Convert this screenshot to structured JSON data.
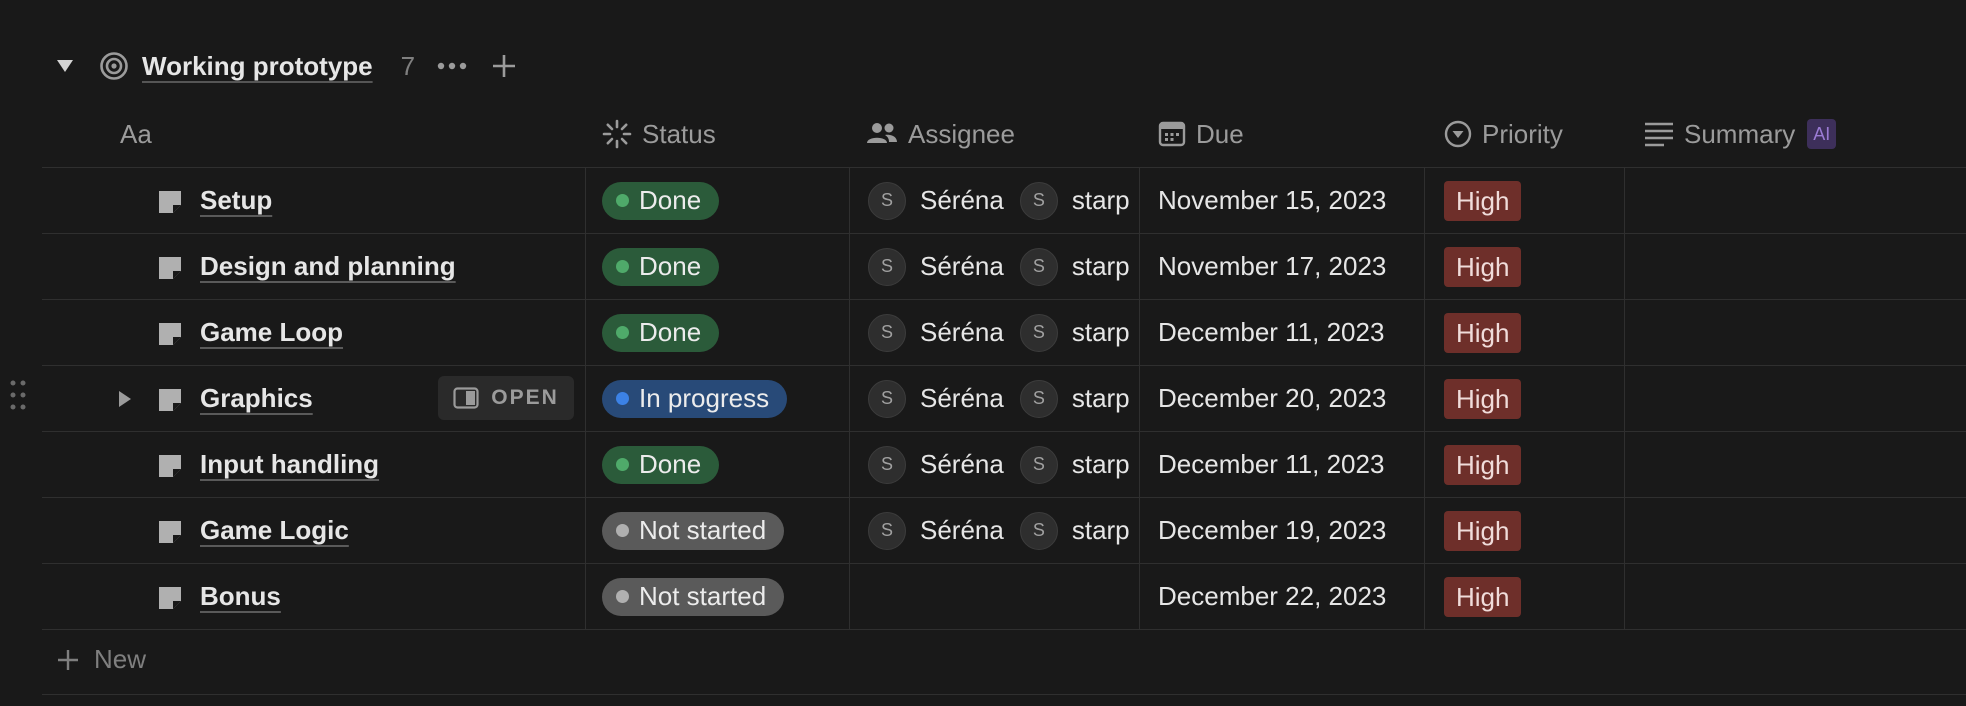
{
  "group": {
    "title": "Working prototype",
    "count": "7"
  },
  "columns": {
    "name": "Aa",
    "status": "Status",
    "assignee": "Assignee",
    "due": "Due",
    "priority": "Priority",
    "summary": "Summary",
    "summary_badge": "AI"
  },
  "rows": [
    {
      "title": "Setup",
      "status": "Done",
      "assignee1_initial": "S",
      "assignee1": "Séréna",
      "assignee2_initial": "S",
      "assignee2": "starp",
      "due": "November 15, 2023",
      "priority": "High"
    },
    {
      "title": "Design and planning",
      "status": "Done",
      "assignee1_initial": "S",
      "assignee1": "Séréna",
      "assignee2_initial": "S",
      "assignee2": "starp",
      "due": "November 17, 2023",
      "priority": "High"
    },
    {
      "title": "Game Loop",
      "status": "Done",
      "assignee1_initial": "S",
      "assignee1": "Séréna",
      "assignee2_initial": "S",
      "assignee2": "starp",
      "due": "December 11, 2023",
      "priority": "High"
    },
    {
      "title": "Graphics",
      "status": "In progress",
      "open_label": "OPEN",
      "assignee1_initial": "S",
      "assignee1": "Séréna",
      "assignee2_initial": "S",
      "assignee2": "starp",
      "due": "December 20, 2023",
      "priority": "High"
    },
    {
      "title": "Input handling",
      "status": "Done",
      "assignee1_initial": "S",
      "assignee1": "Séréna",
      "assignee2_initial": "S",
      "assignee2": "starp",
      "due": "December 11, 2023",
      "priority": "High"
    },
    {
      "title": "Game Logic",
      "status": "Not started",
      "assignee1_initial": "S",
      "assignee1": "Séréna",
      "assignee2_initial": "S",
      "assignee2": "starp",
      "due": "December 19, 2023",
      "priority": "High"
    },
    {
      "title": "Bonus",
      "status": "Not started",
      "due": "December 22, 2023",
      "priority": "High"
    }
  ],
  "new_label": "New",
  "colors": {
    "done_bg": "#2b5b3a",
    "done_dot": "#4faa6a",
    "progress_bg": "#284a78",
    "progress_dot": "#3c82e6",
    "notstarted_bg": "#5a5a5a",
    "notstarted_dot": "#b0b0b0",
    "priority_high_bg": "#6e2f2a"
  },
  "icons": {
    "group": "target-icon",
    "status": "loading-spinner-icon",
    "assignee": "people-icon",
    "due": "calendar-icon",
    "priority": "chevron-circle-icon",
    "summary": "text-lines-icon",
    "page": "page-icon",
    "new": "plus-icon"
  }
}
